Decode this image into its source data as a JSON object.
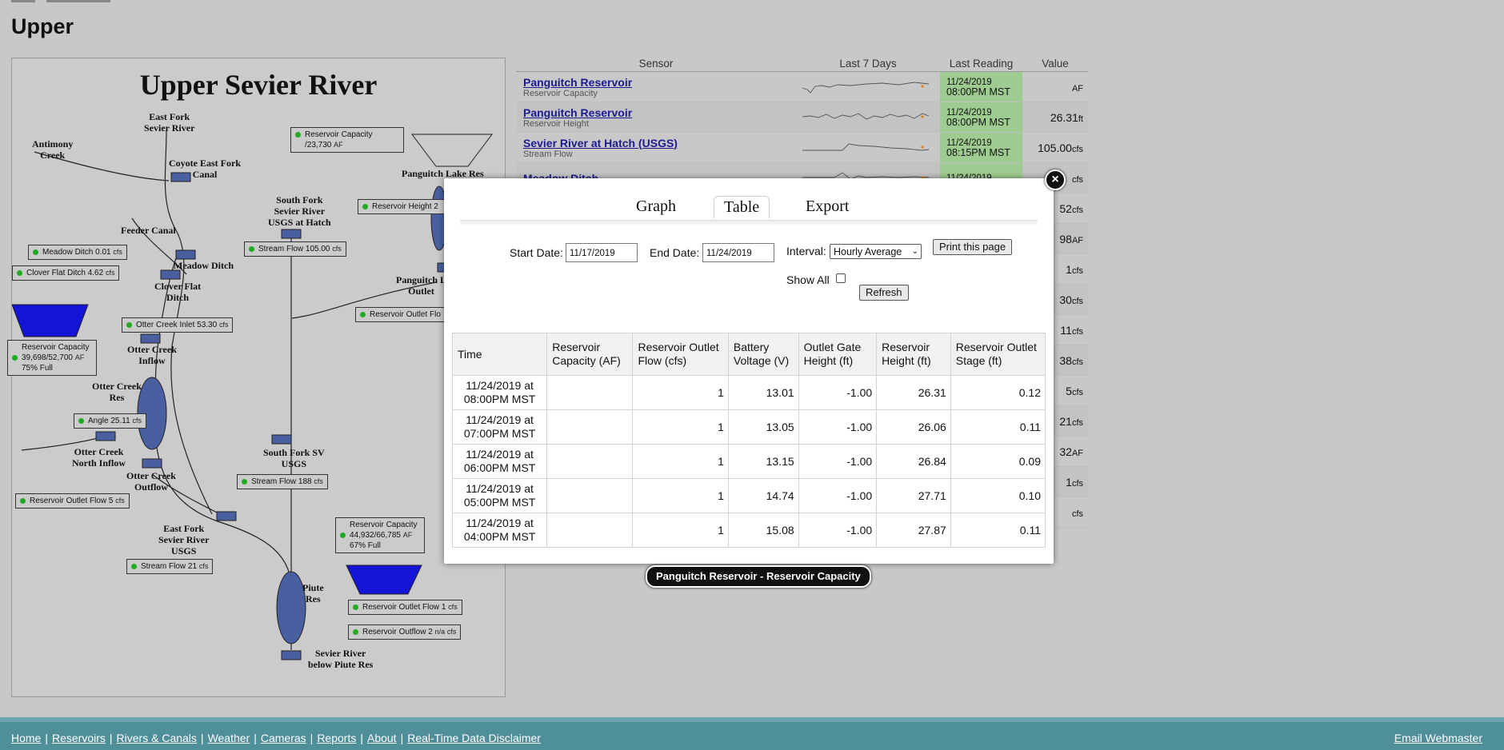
{
  "page_title": "Upper",
  "map": {
    "title": "Upper Sevier River",
    "labels": {
      "east_fork": "East Fork\nSevier River",
      "antimony": "Antimony\nCreek",
      "coyote": "Coyote East Fork\nCanal",
      "feeder": "Feeder Canal",
      "meadow_ditch": "Meadow Ditch",
      "clover_flat": "Clover Flat\nDitch",
      "otter_inflow": "Otter Creek\nInflow",
      "otter_res": "Otter Creek\nRes",
      "otter_north": "Otter Creek\nNorth Inflow",
      "otter_outflow": "Otter Creek\nOutflow",
      "ef_usgs": "East Fork\nSevier River\nUSGS",
      "sf_hatch": "South Fork\nSevier River\nUSGS at Hatch",
      "panguitch_lake": "Panguitch Lake Res",
      "panguitch_outlet": "Panguitch L\nOutlet",
      "sf_sv": "South Fork SV\nUSGS",
      "piute": "Piute\nRes",
      "below_piute": "Sevier River\nbelow Piute Res"
    },
    "widgets": {
      "res_cap_panguitch": {
        "label": "Reservoir Capacity",
        "value": "/23,730",
        "unit": "AF"
      },
      "res_height": {
        "label": "Reservoir Height",
        "value": "2",
        "unit": ""
      },
      "stream_105": {
        "label": "Stream Flow",
        "value": "105.00",
        "unit": "cfs"
      },
      "meadow": {
        "label": "Meadow Ditch",
        "value": "0.01",
        "unit": "cfs"
      },
      "clover": {
        "label": "Clover Flat Ditch",
        "value": "4.62",
        "unit": "cfs"
      },
      "otter_inlet": {
        "label": "Otter Creek Inlet",
        "value": "53.30",
        "unit": "cfs"
      },
      "res_outlet_flo": {
        "label": "Reservoir Outlet Flo",
        "value": "",
        "unit": ""
      },
      "otter_cap": {
        "label": "Reservoir Capacity",
        "value": "39,698/52,700",
        "unit": "AF",
        "pct": "75% Full"
      },
      "angle": {
        "label": "Angle",
        "value": "25.11",
        "unit": "cfs"
      },
      "stream_188": {
        "label": "Stream Flow",
        "value": "188",
        "unit": "cfs"
      },
      "otter_outflow_w": {
        "label": "Reservoir Outlet Flow",
        "value": "5",
        "unit": "cfs"
      },
      "piute_cap": {
        "label": "Reservoir Capacity",
        "value": "44,932/66,785",
        "unit": "AF",
        "pct": "67% Full"
      },
      "stream_21": {
        "label": "Stream Flow",
        "value": "21",
        "unit": "cfs"
      },
      "piute_outlet": {
        "label": "Reservoir Outlet Flow",
        "value": "1",
        "unit": "cfs"
      },
      "piute_outflow2": {
        "label": "Reservoir Outflow 2",
        "value": "n/a",
        "unit": "cfs"
      }
    }
  },
  "sensor_table": {
    "headers": [
      "Sensor",
      "Last 7 Days",
      "Last Reading",
      "Value"
    ],
    "rows": [
      {
        "name": "Panguitch Reservoir",
        "sub": "Reservoir Capacity",
        "date": "11/24/2019",
        "time": "08:00PM MST",
        "value": "",
        "unit": "AF"
      },
      {
        "name": "Panguitch Reservoir",
        "sub": "Reservoir Height",
        "date": "11/24/2019",
        "time": "08:00PM MST",
        "value": "26.31",
        "unit": "ft"
      },
      {
        "name": "Sevier River at Hatch (USGS)",
        "sub": "Stream Flow",
        "date": "11/24/2019",
        "time": "08:15PM MST",
        "value": "105.00",
        "unit": "cfs"
      },
      {
        "name": "Meadow Ditch",
        "sub": "",
        "date": "11/24/2019",
        "time": "",
        "value": "",
        "unit": "cfs"
      },
      {
        "name": "",
        "sub": "",
        "date": "",
        "time": "",
        "value": "52",
        "unit": "cfs"
      },
      {
        "name": "",
        "sub": "",
        "date": "",
        "time": "",
        "value": "98",
        "unit": "AF"
      },
      {
        "name": "",
        "sub": "",
        "date": "",
        "time": "",
        "value": "1",
        "unit": "cfs"
      },
      {
        "name": "",
        "sub": "",
        "date": "",
        "time": "",
        "value": "30",
        "unit": "cfs"
      },
      {
        "name": "",
        "sub": "",
        "date": "",
        "time": "",
        "value": "11",
        "unit": "cfs"
      },
      {
        "name": "",
        "sub": "",
        "date": "",
        "time": "",
        "value": "38",
        "unit": "cfs"
      },
      {
        "name": "",
        "sub": "",
        "date": "",
        "time": "",
        "value": "5",
        "unit": "cfs"
      },
      {
        "name": "",
        "sub": "",
        "date": "",
        "time": "",
        "value": "21",
        "unit": "cfs"
      },
      {
        "name": "",
        "sub": "",
        "date": "",
        "time": "",
        "value": "32",
        "unit": "AF"
      },
      {
        "name": "",
        "sub": "",
        "date": "",
        "time": "",
        "value": "1",
        "unit": "cfs"
      },
      {
        "name": "",
        "sub": "",
        "date": "",
        "time": "",
        "value": "",
        "unit": "cfs"
      }
    ]
  },
  "modal": {
    "tabs": [
      "Graph",
      "Table",
      "Export"
    ],
    "active_tab": "Table",
    "start_label": "Start Date:",
    "start_value": "11/17/2019",
    "end_label": "End Date:",
    "end_value": "11/24/2019",
    "interval_label": "Interval:",
    "interval_value": "Hourly Average",
    "print_label": "Print this page",
    "show_all_label": "Show All",
    "refresh_label": "Refresh",
    "columns": [
      "Time",
      "Reservoir Capacity (AF)",
      "Reservoir Outlet Flow (cfs)",
      "Battery Voltage (V)",
      "Outlet Gate Height (ft)",
      "Reservoir Height (ft)",
      "Reservoir Outlet Stage (ft)"
    ],
    "rows": [
      [
        "11/24/2019 at 08:00PM MST",
        "",
        "1",
        "13.01",
        "-1.00",
        "26.31",
        "0.12"
      ],
      [
        "11/24/2019 at 07:00PM MST",
        "",
        "1",
        "13.05",
        "-1.00",
        "26.06",
        "0.11"
      ],
      [
        "11/24/2019 at 06:00PM MST",
        "",
        "1",
        "13.15",
        "-1.00",
        "26.84",
        "0.09"
      ],
      [
        "11/24/2019 at 05:00PM MST",
        "",
        "1",
        "14.74",
        "-1.00",
        "27.71",
        "0.10"
      ],
      [
        "11/24/2019 at 04:00PM MST",
        "",
        "1",
        "15.08",
        "-1.00",
        "27.87",
        "0.11"
      ]
    ],
    "tooltip": "Panguitch Reservoir - Reservoir Capacity"
  },
  "footer": {
    "links": [
      "Home",
      "Reservoirs",
      "Rivers & Canals",
      "Weather",
      "Cameras",
      "Reports",
      "About",
      "Real-Time Data Disclaimer"
    ],
    "email": "Email Webmaster"
  },
  "colors": {
    "reservoir_blue": "#1414d6",
    "node_blue": "#4a5fa0",
    "status_green": "#22aa22",
    "reading_green": "#9ecb8f",
    "footer": "#4f8f9a"
  }
}
